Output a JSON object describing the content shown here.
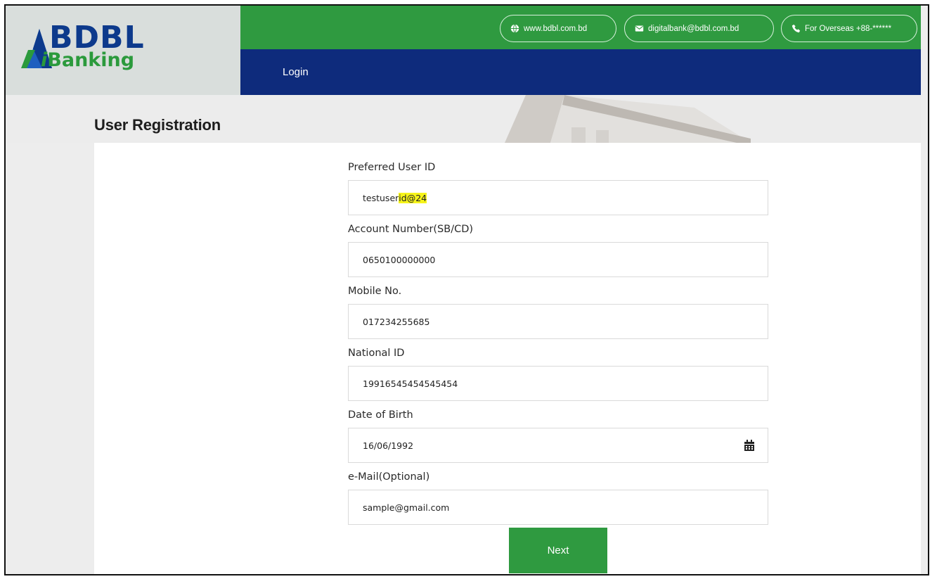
{
  "brand": {
    "name": "BDBL",
    "product": "Banking",
    "product_prefix": "i",
    "colors": {
      "green": "#2f9a40",
      "navy": "#0e2b7c",
      "logo_blue": "#0d3a8c"
    }
  },
  "topbar": {
    "website": {
      "icon": "globe-icon",
      "label": "www.bdbl.com.bd"
    },
    "email": {
      "icon": "envelope-icon",
      "label": "digitalbank@bdbl.com.bd"
    },
    "phone": {
      "icon": "phone-icon",
      "label": "For Overseas +88-******"
    }
  },
  "nav": {
    "login_label": "Login"
  },
  "page": {
    "title": "User Registration"
  },
  "form": {
    "user_id": {
      "label": "Preferred User ID",
      "value_plain": "testuser",
      "value_highlight": "id@24"
    },
    "account": {
      "label": "Account Number(SB/CD)",
      "value": "0650100000000"
    },
    "mobile": {
      "label": "Mobile No.",
      "value": "017234255685"
    },
    "nid": {
      "label": "National ID",
      "value": "19916545454545454"
    },
    "dob": {
      "label": "Date of Birth",
      "value": "16/06/1992",
      "icon": "calendar-icon"
    },
    "email": {
      "label": "e-Mail(Optional)",
      "value": "sample@gmail.com"
    },
    "next_label": "Next"
  }
}
